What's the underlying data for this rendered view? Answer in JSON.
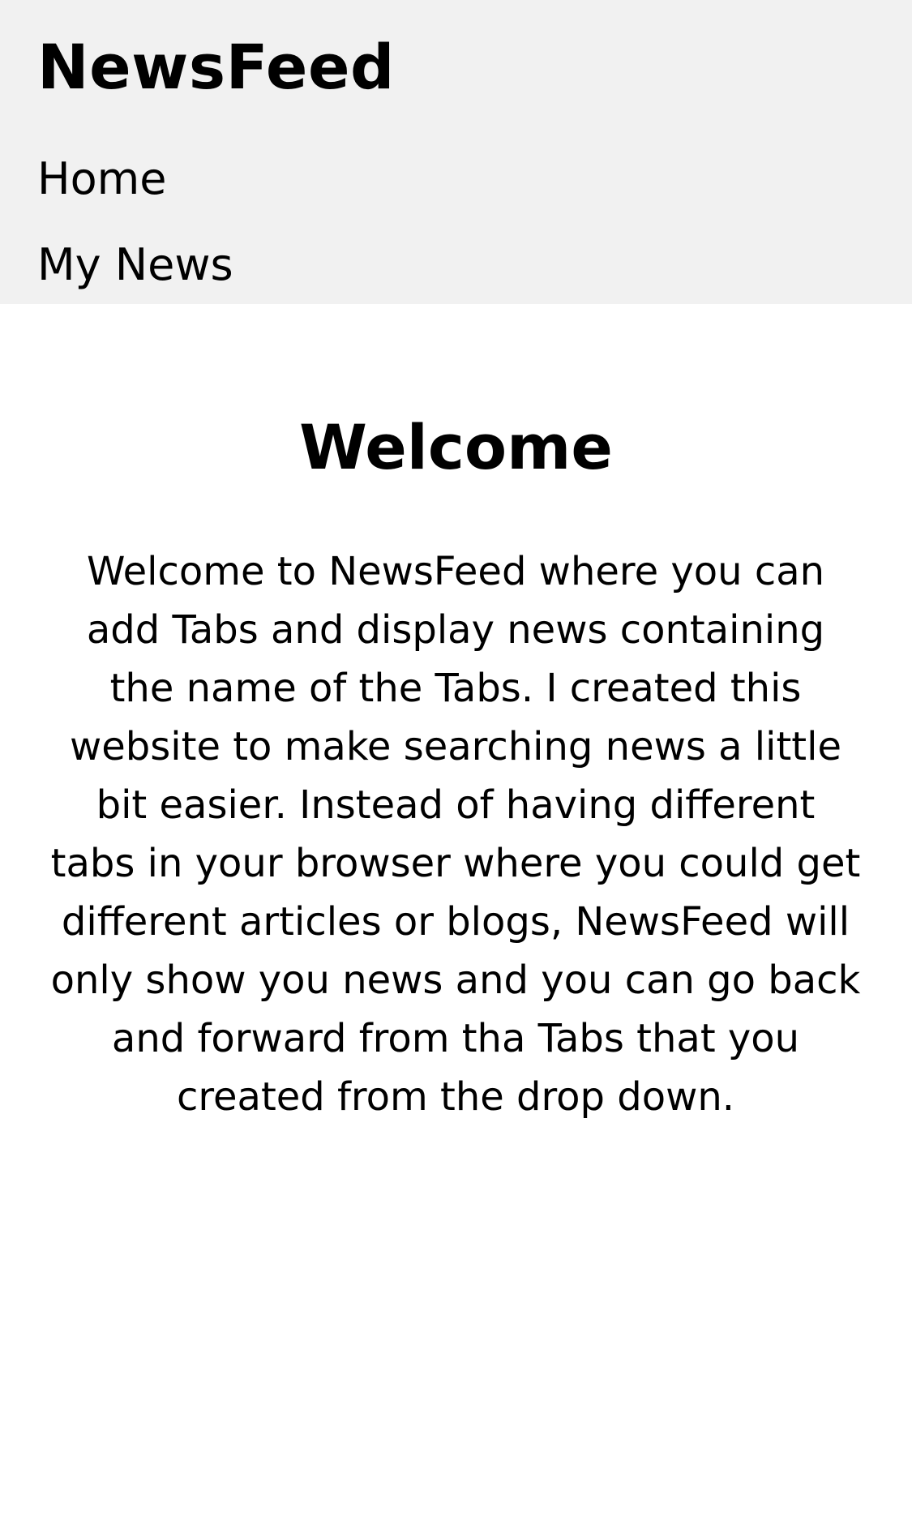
{
  "header": {
    "brand": "NewsFeed",
    "nav": {
      "home": "Home",
      "my_news": "My News"
    },
    "background_color": "#f1f1f1"
  },
  "main": {
    "title": "Welcome",
    "paragraph": "Welcome to NewsFeed where you can add Tabs and display news containing the name of the Tabs. I created this website to make searching news a little bit easier. Instead of having different tabs in your browser where you could get different articles or blogs, NewsFeed will only show you news and you can go back and forward from tha Tabs that you created from the drop down."
  }
}
